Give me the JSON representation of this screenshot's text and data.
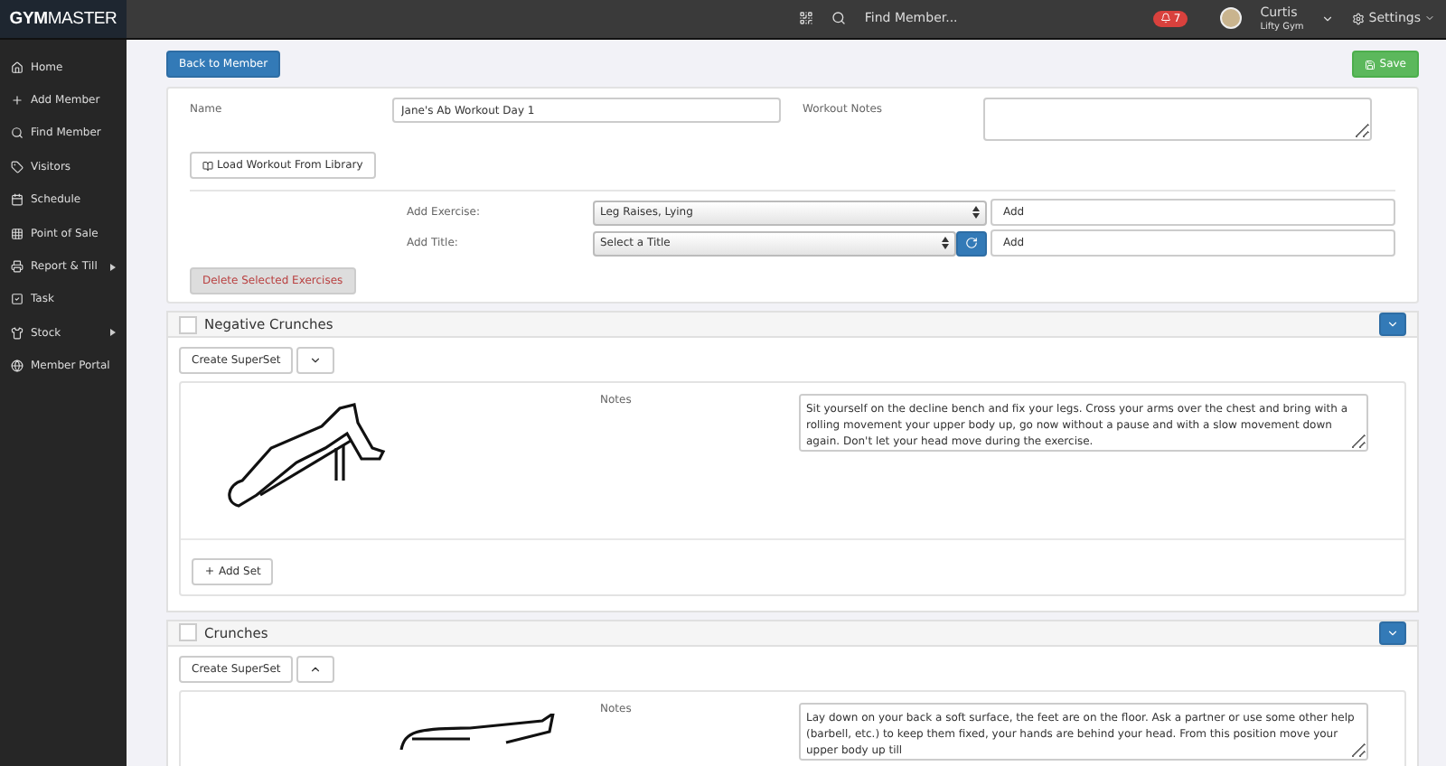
{
  "brand": {
    "bold": "GYM",
    "light": "MASTER"
  },
  "topbar": {
    "search_placeholder": "Find Member...",
    "notifications": "7",
    "user": {
      "name": "Curtis",
      "gym": "Lifty Gym"
    },
    "settings": "Settings"
  },
  "sidebar": {
    "items": [
      {
        "label": "Home",
        "submenu": false
      },
      {
        "label": "Add Member",
        "submenu": false
      },
      {
        "label": "Find Member",
        "submenu": false
      },
      {
        "label": "Visitors",
        "submenu": false
      },
      {
        "label": "Schedule",
        "submenu": false
      },
      {
        "label": "Point of Sale",
        "submenu": false
      },
      {
        "label": "Report & Till",
        "submenu": true
      },
      {
        "label": "Task",
        "submenu": false
      },
      {
        "label": "Stock",
        "submenu": true
      },
      {
        "label": "Member Portal",
        "submenu": false
      }
    ]
  },
  "back_button": "Back to Member",
  "save_button": "Save",
  "form": {
    "name_label": "Name",
    "name_value": "Jane's Ab Workout Day 1",
    "notes_label": "Workout Notes",
    "load_button": "Load Workout From Library",
    "add_exercise_label": "Add Exercise:",
    "add_exercise_value": "Leg Raises, Lying",
    "add_title_label": "Add Title:",
    "add_title_value": "Select a Title",
    "add_button": "Add",
    "add_title_button": "Add",
    "delete_button": "Delete Selected Exercises",
    "delete_disabled": true
  },
  "exercises": [
    {
      "name": "Negative Crunches",
      "checked": false,
      "superset_button": "Create SuperSet",
      "notes_label": "Notes",
      "notes": "Sit yourself on the decline bench and fix your legs. Cross your arms over the chest and bring with a rolling movement your upper body up, go now without a pause and with a slow movement down again. Don't let your head move during the exercise.",
      "add_set_button": "Add Set"
    },
    {
      "name": "Crunches",
      "checked": false,
      "superset_button": "Create SuperSet",
      "notes_label": "Notes",
      "notes": "Lay down on your back a soft surface, the feet are on the floor. Ask a partner or use some other help (barbell, etc.) to keep them fixed, your hands are behind your head. From this position move your upper body up till"
    }
  ]
}
